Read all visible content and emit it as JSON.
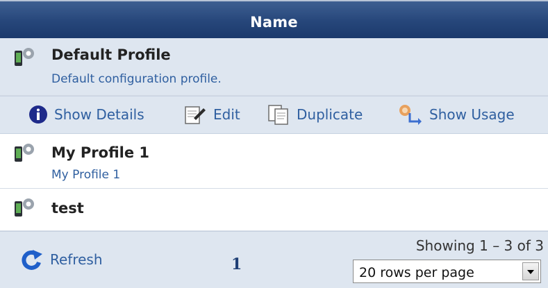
{
  "table": {
    "header": "Name"
  },
  "rows": [
    {
      "title": "Default Profile",
      "description": "Default configuration profile.",
      "icon": "profile-gear-icon"
    },
    {
      "title": "My Profile 1",
      "description": "My Profile 1",
      "icon": "profile-gear-icon"
    },
    {
      "title": "test",
      "description": "",
      "icon": "profile-gear-icon"
    }
  ],
  "actions": {
    "show_details": "Show Details",
    "edit": "Edit",
    "duplicate": "Duplicate",
    "show_usage": "Show Usage"
  },
  "footer": {
    "refresh": "Refresh",
    "current_page": "1",
    "showing": "Showing 1 – 3 of 3",
    "rows_per_page": "20 rows per page"
  },
  "colors": {
    "header_bg": "#26467a",
    "selected_row_bg": "#dee6f0",
    "link": "#2f5fa0"
  }
}
